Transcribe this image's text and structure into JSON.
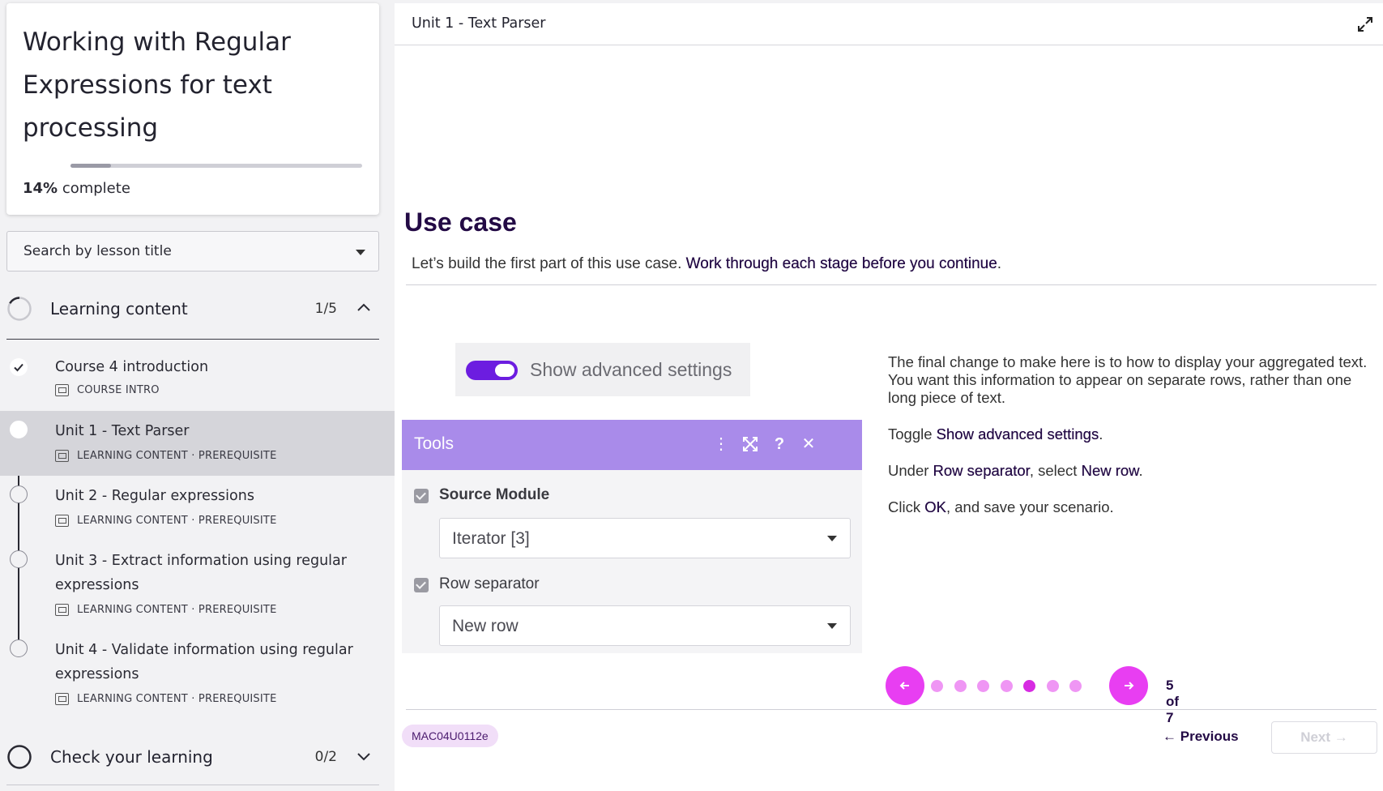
{
  "course": {
    "title": "Working with Regular Expressions for text processing",
    "progress_value": "14%",
    "progress_suffix": " complete",
    "progress_fraction": 0.14
  },
  "search": {
    "placeholder": "Search by lesson title"
  },
  "sections": [
    {
      "title": "Learning content",
      "count": "1/5",
      "expanded": true
    },
    {
      "title": "Check your learning",
      "count": "0/2",
      "expanded": false
    }
  ],
  "lessons": [
    {
      "name": "Course 4 introduction",
      "meta": "COURSE INTRO",
      "status": "completed"
    },
    {
      "name": "Unit 1 - Text Parser",
      "meta": "LEARNING CONTENT · PREREQUISITE",
      "status": "current"
    },
    {
      "name": "Unit 2 - Regular expressions",
      "meta": "LEARNING CONTENT · PREREQUISITE",
      "status": "not-started"
    },
    {
      "name": "Unit 3 - Extract information using regular expressions",
      "meta": "LEARNING CONTENT · PREREQUISITE",
      "status": "not-started"
    },
    {
      "name": "Unit 4 - Validate information using regular expressions",
      "meta": "LEARNING CONTENT · PREREQUISITE",
      "status": "not-started"
    }
  ],
  "main": {
    "unit_title": "Unit 1 - Text Parser",
    "heading": "Use case",
    "lead_plain": "Let’s build the first part of this use case. ",
    "lead_bold": "Work through each stage before you continue",
    "lead_end": ".",
    "illustration": {
      "toggle_label": "Show advanced settings",
      "toggle_on": true,
      "panel_title": "Tools",
      "source_module_label": "Source Module",
      "source_module_value": "Iterator [3]",
      "row_separator_label": "Row separator",
      "row_separator_value": "New row"
    },
    "instructions": {
      "p1": "The final change to make here is to how to display your aggregated text. You want this information to appear on separate rows, rather than one long piece of text.",
      "p2_a": "Toggle ",
      "p2_b": "Show advanced settings",
      "p2_c": ".",
      "p3_a": "Under ",
      "p3_b": "Row separator",
      "p3_c": ", select ",
      "p3_d": "New row",
      "p3_e": ".",
      "p4_a": "Click ",
      "p4_b": "OK",
      "p4_c": ", and save your scenario."
    },
    "carousel": {
      "current": 5,
      "total": 7,
      "label": "5 of 7"
    },
    "module_code": "MAC04U0112e",
    "previous_label": "Previous",
    "next_label": "Next"
  },
  "colors": {
    "accent_magenta": "#e83ef2",
    "accent_purple": "#6c1de0",
    "tools_header": "#a98bea",
    "heading_text": "#230a45"
  }
}
